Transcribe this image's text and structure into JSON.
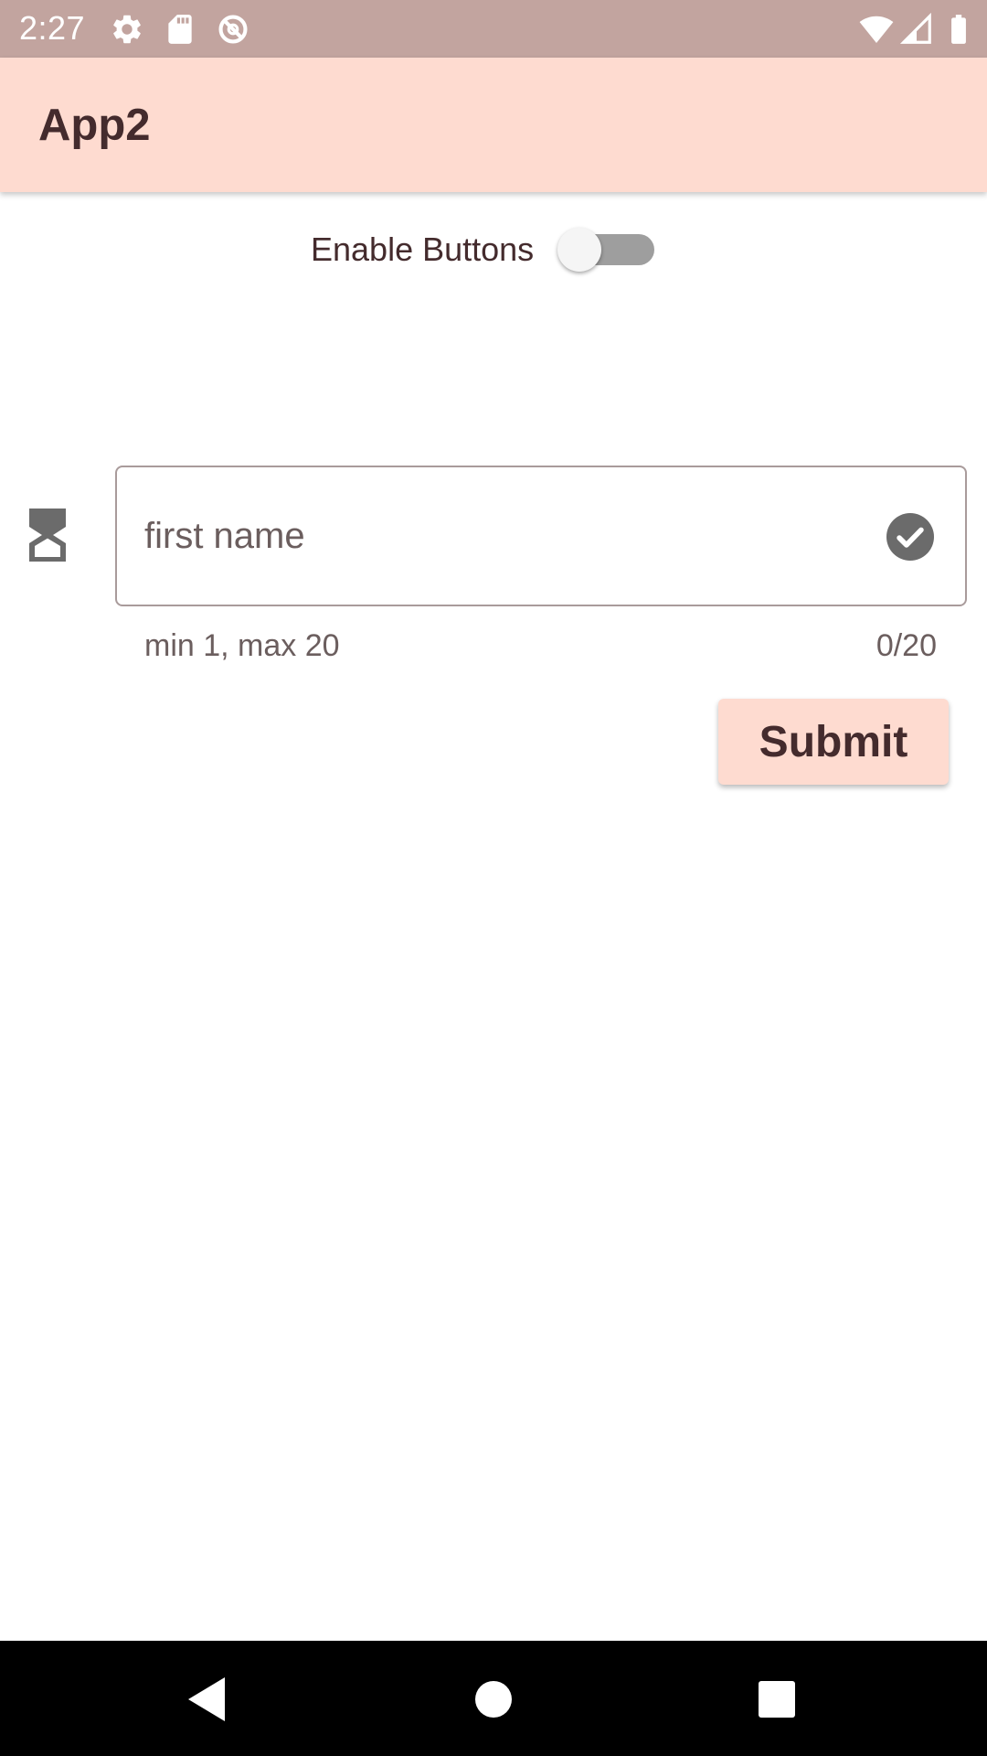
{
  "status_bar": {
    "time": "2:27",
    "icons": [
      "gear-icon",
      "sd-card-icon",
      "sync-disabled-icon",
      "wifi-icon",
      "cell-signal-icon",
      "battery-icon"
    ],
    "background": "#c2a49f"
  },
  "app_bar": {
    "title": "App2",
    "background": "#fedbd0"
  },
  "toggle": {
    "label": "Enable Buttons",
    "enabled": false
  },
  "form": {
    "prefix_icon": "hourglass-icon",
    "input": {
      "value": "",
      "placeholder": "first name",
      "suffix_icon": "check-circle-icon"
    },
    "helper_text": "min 1, max 20",
    "counter": "0/20"
  },
  "submit_button": {
    "label": "Submit"
  },
  "nav_bar": {
    "buttons": [
      "back-icon",
      "home-icon",
      "recents-icon"
    ]
  },
  "colors": {
    "accent": "#fedbd0",
    "text": "#442b2d",
    "muted_text": "#6b5e5e",
    "outline": "#a99b9b"
  }
}
